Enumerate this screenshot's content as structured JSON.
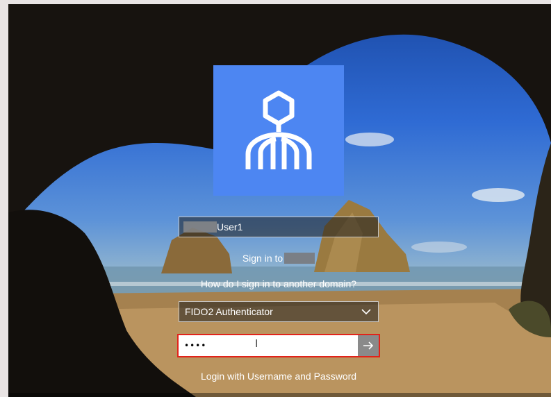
{
  "login": {
    "username": "User1",
    "sign_in_to": "Sign in to",
    "other_domain_link": "How do I sign in to another domain?",
    "auth_method": "FIDO2 Authenticator",
    "pin_value": "••••",
    "alt_login_link": "Login with Username and Password"
  },
  "icons": {
    "logo": "fido-logo-icon",
    "submit": "arrow-right-icon",
    "dropdown": "chevron-down-icon",
    "cursor": "text-cursor-icon"
  },
  "colors": {
    "logo_tile": "#4d86f2",
    "pin_border": "#e2231a"
  }
}
